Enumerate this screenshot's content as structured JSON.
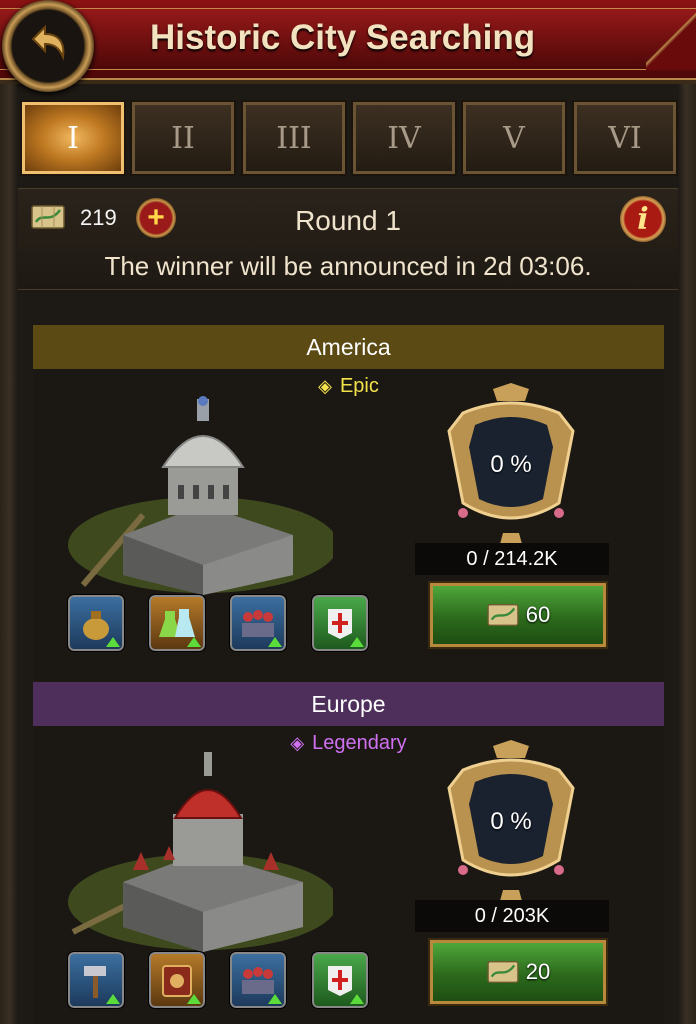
{
  "header": {
    "title": "Historic City Searching",
    "back_icon": "back-arrow-icon"
  },
  "tabs": [
    {
      "label": "I",
      "active": true
    },
    {
      "label": "II",
      "active": false
    },
    {
      "label": "III",
      "active": false
    },
    {
      "label": "IV",
      "active": false
    },
    {
      "label": "V",
      "active": false
    },
    {
      "label": "VI",
      "active": false
    }
  ],
  "info": {
    "token_count": "219",
    "round_title": "Round 1",
    "countdown": "The winner will be announced in 2d 03:06."
  },
  "cities": [
    {
      "region": "America",
      "rarity": "Epic",
      "rarity_color": "#f3e24a",
      "header_color": "#5c4a14",
      "progress_percent": "0 %",
      "progress_text": "0 / 214.2K",
      "claim_cost": "60",
      "buff_icons": [
        "resource-bag-icon",
        "research-flask-icon",
        "troops-icon",
        "banner-icon"
      ]
    },
    {
      "region": "Europe",
      "rarity": "Legendary",
      "rarity_color": "#d070f0",
      "header_color": "#4e2f5c",
      "progress_percent": "0 %",
      "progress_text": "0 / 203K",
      "claim_cost": "20",
      "buff_icons": [
        "hammer-icon",
        "book-icon",
        "troops-icon",
        "banner-icon"
      ]
    }
  ]
}
